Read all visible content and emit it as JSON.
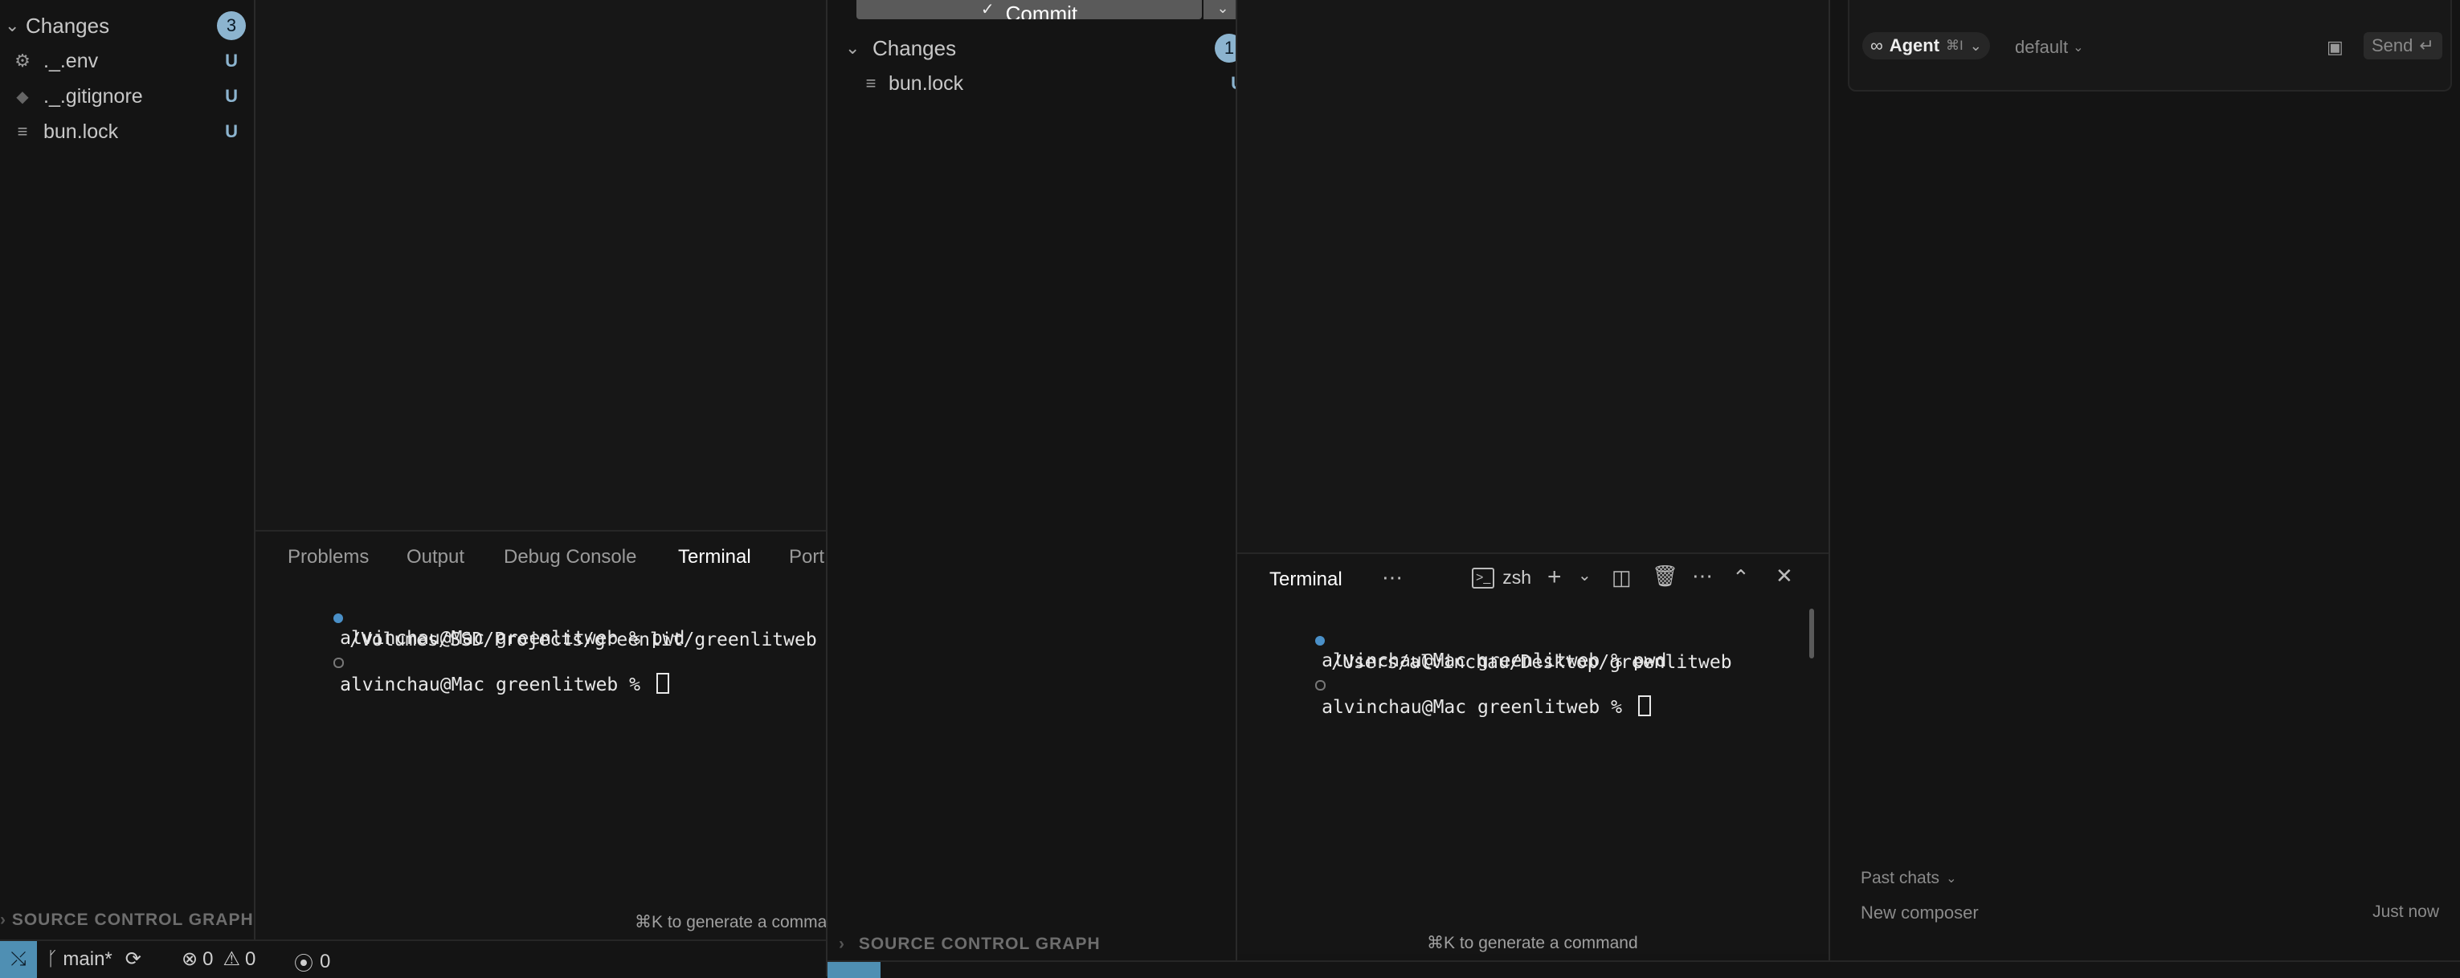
{
  "left_sidebar": {
    "changes_title": "Changes",
    "changes_count": "3",
    "files": [
      {
        "name": "._.env",
        "status": "U",
        "icon": "gear-icon"
      },
      {
        "name": "._.gitignore",
        "status": "U",
        "icon": "diamond-icon"
      },
      {
        "name": "bun.lock",
        "status": "U",
        "icon": "file-lines-icon"
      }
    ],
    "graph_title": "SOURCE CONTROL GRAPH"
  },
  "left_panel": {
    "tabs": [
      "Problems",
      "Output",
      "Debug Console",
      "Terminal",
      "Port"
    ],
    "active_tab": "Terminal",
    "terminal_lines": [
      "alvinchau@Mac greenlitweb % pwd",
      "/Volumes/SSD/Projects/greenlit/greenlitweb",
      "alvinchau@Mac greenlitweb % "
    ],
    "hint": "⌘K to generate a comma"
  },
  "status_bar_left": {
    "branch": "main*",
    "errors": "0",
    "warnings": "0",
    "ports": "0"
  },
  "middle_sidebar": {
    "commit_label": "Commit",
    "changes_title": "Changes",
    "changes_count": "1",
    "files": [
      {
        "name": "bun.lock",
        "status": "U",
        "icon": "file-lines-icon"
      }
    ],
    "graph_title": "SOURCE CONTROL GRAPH"
  },
  "right_terminal": {
    "title": "Terminal",
    "shell": "zsh",
    "lines": [
      "alvinchau@Mac greenlitweb % pwd",
      "/Users/alvinchau/Desktop/greenlitweb",
      "alvinchau@Mac greenlitweb % "
    ],
    "hint": "⌘K to generate a command"
  },
  "chat": {
    "mode_label": "Agent",
    "mode_shortcut": "⌘I",
    "model": "default",
    "send_label": "Send",
    "send_shortcut": "↵",
    "past_chats": "Past chats",
    "composer_title": "New composer",
    "composer_time": "Just now"
  },
  "colors": {
    "accent": "#8cb4cf",
    "background": "#141414",
    "remote_indicator": "#4f8fb3"
  }
}
